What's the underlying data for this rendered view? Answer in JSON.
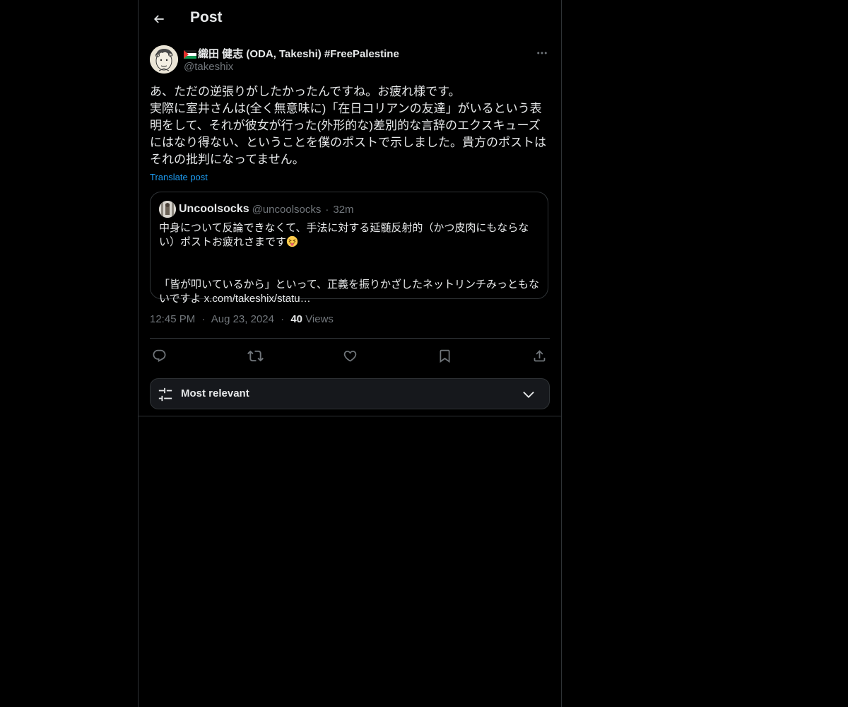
{
  "header": {
    "title": "Post",
    "back_icon": "arrow-left-icon"
  },
  "post": {
    "author": {
      "display_name": "織田 健志 (ODA, Takeshi) #FreePalestine",
      "handle": "@takeshix",
      "flag_icon": "palestine-flag-icon"
    },
    "text": "あ、ただの逆張りがしたかったんですね。お疲れ様です。\n実際に室井さんは(全く無意味に)「在日コリアンの友達」がいるという表明をして、それが彼女が行った(外形的な)差別的な言辞のエクスキューズにはなり得ない、ということを僕のポストで示しました。貴方のポストはそれの批判になってません。",
    "translate_label": "Translate post",
    "quote": {
      "name": "Uncoolsocks",
      "handle": "@uncoolsocks",
      "separator": "·",
      "time": "32m",
      "text_line1": "中身について反論できなくて、手法に対する延髄反射的（かつ皮肉にもならない）ポストお疲れさまです",
      "text_line2": "「皆が叩いているから」といって、正義を振りかざしたネットリンチみっともないですよ x.com/takeshix/statu…",
      "emoji": "squinting-face-with-tongue-emoji"
    },
    "meta": {
      "time": "12:45 PM",
      "sep1": "·",
      "date": "Aug 23, 2024",
      "sep2": "·",
      "views_count": "40",
      "views_label": "Views"
    }
  },
  "actions": {
    "reply_icon": "reply-icon",
    "repost_icon": "repost-icon",
    "like_icon": "heart-icon",
    "bookmark_icon": "bookmark-icon",
    "share_icon": "share-icon"
  },
  "sort": {
    "label": "Most relevant"
  },
  "colors": {
    "background": "#000000",
    "text": "#e7e9ea",
    "muted": "#71767b",
    "link": "#1d9bf0",
    "border": "#2f3336"
  }
}
